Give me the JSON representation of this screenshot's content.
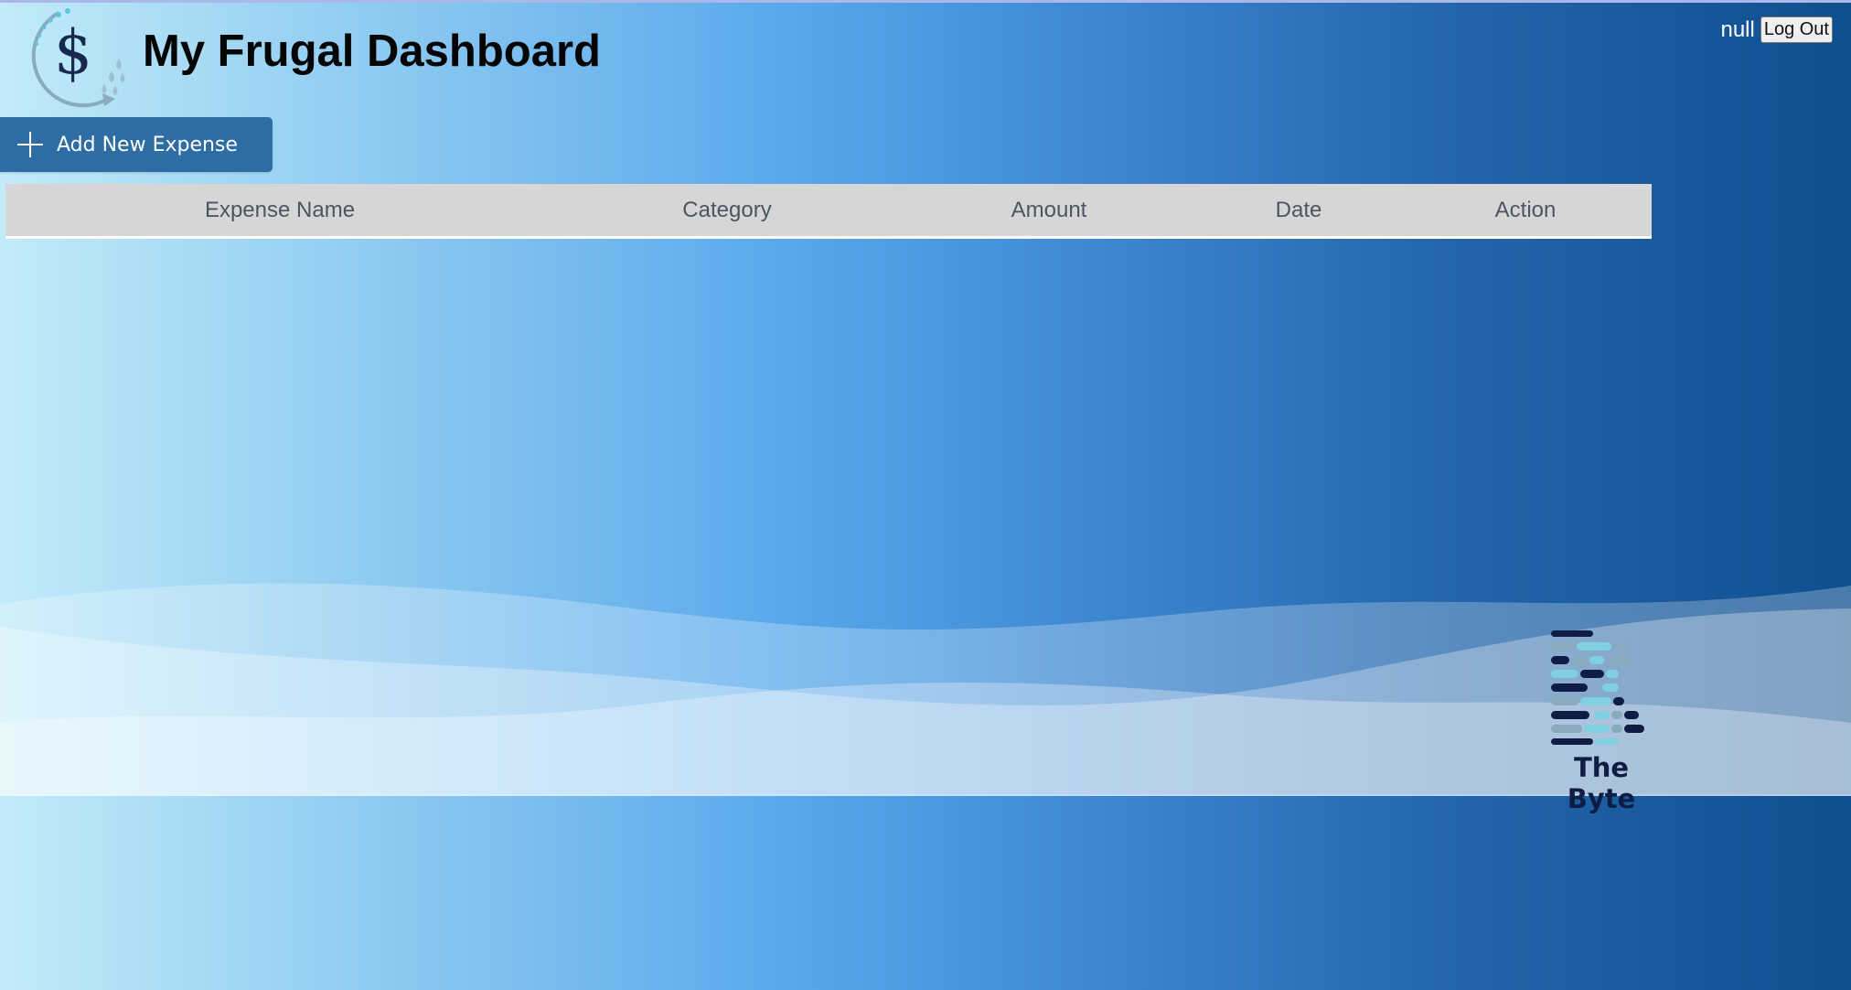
{
  "header": {
    "title": "My Frugal Dashboard",
    "username": "null",
    "logout_label": "Log Out"
  },
  "toolbar": {
    "add_expense_label": "Add New Expense"
  },
  "table": {
    "columns": [
      "Expense Name",
      "Category",
      "Amount",
      "Date",
      "Action"
    ],
    "rows": []
  },
  "footer": {
    "brand": "The Byte"
  },
  "icons": {
    "app_logo": "dollar-cycle-icon",
    "add": "plus-icon",
    "brand_logo": "byte-bars-logo"
  }
}
